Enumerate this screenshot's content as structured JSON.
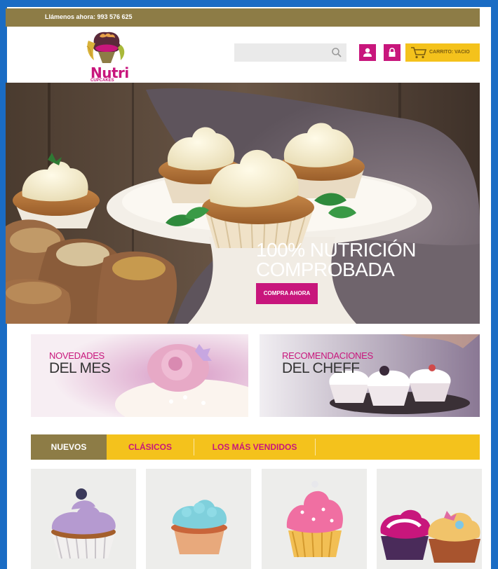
{
  "topbar": {
    "phone": "Llámenos ahora: 993 576 625"
  },
  "header": {
    "logo": {
      "brand": "Nutri",
      "sub": "CUPCAKES"
    },
    "search": {
      "placeholder": ""
    },
    "cart_label": "CARRITO: VACIO"
  },
  "hero": {
    "line1": "100% NUTRICIÓN",
    "line2": "COMPROBADA",
    "button": "COMPRA AHORA"
  },
  "banners": [
    {
      "line1": "NOVEDADES",
      "line2": "DEL MES"
    },
    {
      "line1": "RECOMENDACIONES",
      "line2": "DEL CHEFF"
    }
  ],
  "tabs": [
    {
      "label": "NUEVOS",
      "active": true
    },
    {
      "label": "CLÁSICOS",
      "active": false
    },
    {
      "label": "LOS MÁS VENDIDOS",
      "active": false
    }
  ],
  "colors": {
    "brand_pink": "#c8167c",
    "brand_gold": "#8d7c46",
    "accent_yellow": "#f4c21c",
    "frame_blue": "#1a6cc4"
  },
  "products": [
    {
      "icon": "purple-cupcake"
    },
    {
      "icon": "teal-cupcake"
    },
    {
      "icon": "pink-cupcake"
    },
    {
      "icon": "two-cupcakes"
    }
  ]
}
